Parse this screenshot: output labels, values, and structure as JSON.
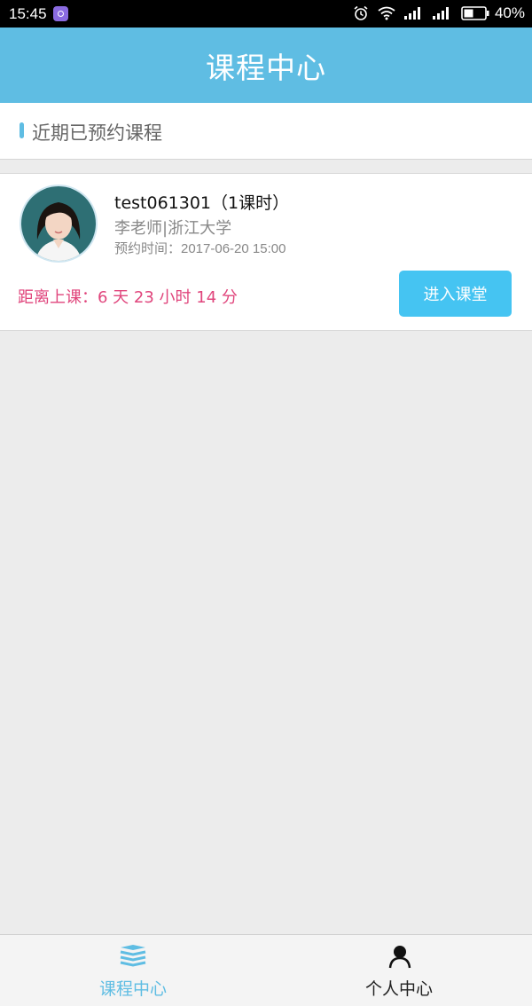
{
  "status_bar": {
    "time": "15:45",
    "battery": "40%"
  },
  "header": {
    "title": "课程中心"
  },
  "section": {
    "title": "近期已预约课程"
  },
  "course": {
    "title": "test061301（1课时）",
    "teacher": "李老师|浙江大学",
    "booking_time": "预约时间：2017-06-20 15:00",
    "countdown": "距离上课：6 天 23 小时 14 分",
    "enter_label": "进入课堂"
  },
  "bottom_nav": {
    "items": [
      {
        "label": "课程中心",
        "icon": "books-icon",
        "active": true
      },
      {
        "label": "个人中心",
        "icon": "person-icon",
        "active": false
      }
    ]
  },
  "colors": {
    "primary": "#5fbde3",
    "button": "#45c4f2",
    "countdown": "#e0457c"
  }
}
